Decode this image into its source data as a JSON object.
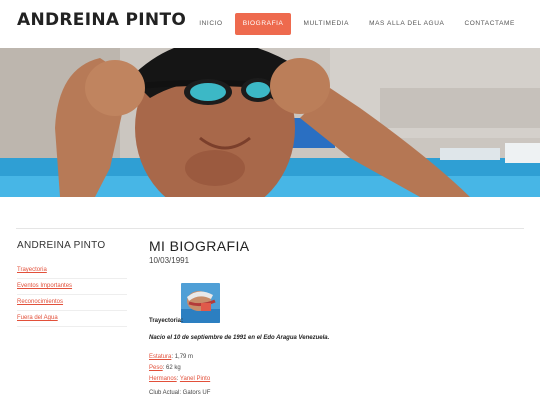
{
  "site": {
    "title": "ANDREINA PINTO"
  },
  "nav": [
    {
      "label": "INICIO",
      "active": false
    },
    {
      "label": "BIOGRAFIA",
      "active": true
    },
    {
      "label": "MULTIMEDIA",
      "active": false
    },
    {
      "label": "MAS ALLA DEL AGUA",
      "active": false
    },
    {
      "label": "CONTACTAME",
      "active": false
    }
  ],
  "sidebar": {
    "title": "ANDREINA PINTO",
    "links": [
      "Trayectoria",
      "Eventos Importantes",
      "Reconocimientos",
      "Fuera del Agua"
    ]
  },
  "main": {
    "title": "MI BIOGRAFIA",
    "date": "10/03/1991",
    "trayectoria_label": "Trayectoria:",
    "born": "Nacio el 10 de septiembre de 1991 en el Edo Aragua Venezuela.",
    "height_label": "Estatura",
    "height_value": ": 1,79 m",
    "weight_label": "Peso",
    "weight_value": ": 62 kg",
    "siblings_label": "Hermanos",
    "siblings_sep": ": ",
    "siblings_value": "Yanel Pinto",
    "club": "Club Actual: Gators UF"
  },
  "colors": {
    "accent": "#ee6a4e",
    "link": "#e2503a"
  }
}
